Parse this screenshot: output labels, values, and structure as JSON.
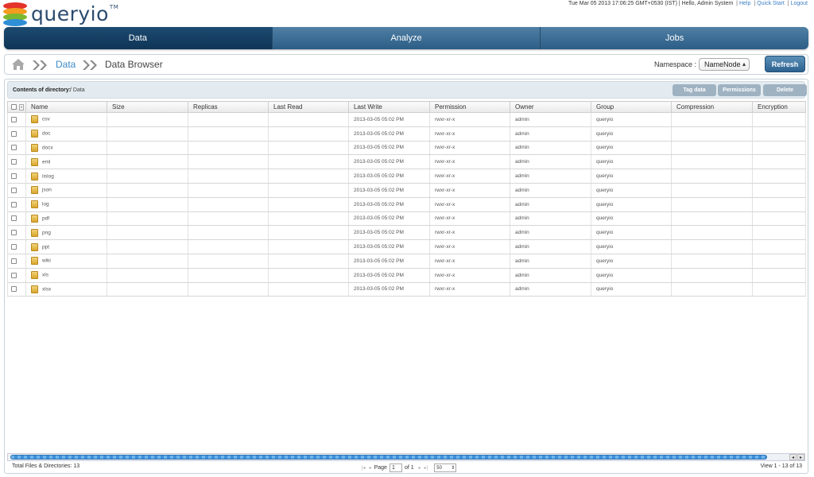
{
  "app": {
    "logo_text": "queryio",
    "logo_tm": "TM"
  },
  "topbar": {
    "datetime": "Tue Mar 05 2013 17:06:25 GMT+0530 (IST)",
    "greeting": "| Hello,  Admin System",
    "help": "Help",
    "quick_start": "Quick Start",
    "logout": "Logout"
  },
  "nav": {
    "tabs": [
      {
        "label": "Data",
        "active": true
      },
      {
        "label": "Analyze",
        "active": false
      },
      {
        "label": "Jobs",
        "active": false
      }
    ]
  },
  "breadcrumb": {
    "home_icon": "home-icon",
    "items": [
      "Data",
      "Data Browser"
    ]
  },
  "namespace": {
    "label": "Namespace :",
    "selected": "NameNode"
  },
  "refresh_label": "Refresh",
  "directory": {
    "label": "Contents of directory:",
    "path": "/ Data"
  },
  "actions": {
    "tag": "Tag data",
    "permissions": "Permissions",
    "delete": "Delete"
  },
  "columns": [
    "Name",
    "Size",
    "Replicas",
    "Last Read",
    "Last Write",
    "Permission",
    "Owner",
    "Group",
    "Compression",
    "Encryption"
  ],
  "rows": [
    {
      "name": "csv",
      "size": "",
      "replicas": "",
      "last_read": "",
      "last_write": "2013-03-05 05:02 PM",
      "permission": "rwxr-xr-x",
      "owner": "admin",
      "group": "queryio",
      "compression": "",
      "encryption": ""
    },
    {
      "name": "doc",
      "size": "",
      "replicas": "",
      "last_read": "",
      "last_write": "2013-03-05 05:02 PM",
      "permission": "rwxr-xr-x",
      "owner": "admin",
      "group": "queryio",
      "compression": "",
      "encryption": ""
    },
    {
      "name": "docx",
      "size": "",
      "replicas": "",
      "last_read": "",
      "last_write": "2013-03-05 05:02 PM",
      "permission": "rwxr-xr-x",
      "owner": "admin",
      "group": "queryio",
      "compression": "",
      "encryption": ""
    },
    {
      "name": "eml",
      "size": "",
      "replicas": "",
      "last_read": "",
      "last_write": "2013-03-05 05:02 PM",
      "permission": "rwxr-xr-x",
      "owner": "admin",
      "group": "queryio",
      "compression": "",
      "encryption": ""
    },
    {
      "name": "iislog",
      "size": "",
      "replicas": "",
      "last_read": "",
      "last_write": "2013-03-05 05:02 PM",
      "permission": "rwxr-xr-x",
      "owner": "admin",
      "group": "queryio",
      "compression": "",
      "encryption": ""
    },
    {
      "name": "json",
      "size": "",
      "replicas": "",
      "last_read": "",
      "last_write": "2013-03-05 05:02 PM",
      "permission": "rwxr-xr-x",
      "owner": "admin",
      "group": "queryio",
      "compression": "",
      "encryption": ""
    },
    {
      "name": "log",
      "size": "",
      "replicas": "",
      "last_read": "",
      "last_write": "2013-03-05 05:02 PM",
      "permission": "rwxr-xr-x",
      "owner": "admin",
      "group": "queryio",
      "compression": "",
      "encryption": ""
    },
    {
      "name": "pdf",
      "size": "",
      "replicas": "",
      "last_read": "",
      "last_write": "2013-03-05 05:02 PM",
      "permission": "rwxr-xr-x",
      "owner": "admin",
      "group": "queryio",
      "compression": "",
      "encryption": ""
    },
    {
      "name": "png",
      "size": "",
      "replicas": "",
      "last_read": "",
      "last_write": "2013-03-05 05:02 PM",
      "permission": "rwxr-xr-x",
      "owner": "admin",
      "group": "queryio",
      "compression": "",
      "encryption": ""
    },
    {
      "name": "ppt",
      "size": "",
      "replicas": "",
      "last_read": "",
      "last_write": "2013-03-05 05:02 PM",
      "permission": "rwxr-xr-x",
      "owner": "admin",
      "group": "queryio",
      "compression": "",
      "encryption": ""
    },
    {
      "name": "wiki",
      "size": "",
      "replicas": "",
      "last_read": "",
      "last_write": "2013-03-05 05:02 PM",
      "permission": "rwxr-xr-x",
      "owner": "admin",
      "group": "queryio",
      "compression": "",
      "encryption": ""
    },
    {
      "name": "xls",
      "size": "",
      "replicas": "",
      "last_read": "",
      "last_write": "2013-03-05 05:02 PM",
      "permission": "rwxr-xr-x",
      "owner": "admin",
      "group": "queryio",
      "compression": "",
      "encryption": ""
    },
    {
      "name": "xlsx",
      "size": "",
      "replicas": "",
      "last_read": "",
      "last_write": "2013-03-05 05:02 PM",
      "permission": "rwxr-xr-x",
      "owner": "admin",
      "group": "queryio",
      "compression": "",
      "encryption": ""
    }
  ],
  "footer": {
    "total": "Total Files & Directories: 13",
    "page_label": "Page",
    "page_value": "1",
    "of_label": "of 1",
    "page_size": "50",
    "view_info": "View 1 - 13 of 13"
  }
}
